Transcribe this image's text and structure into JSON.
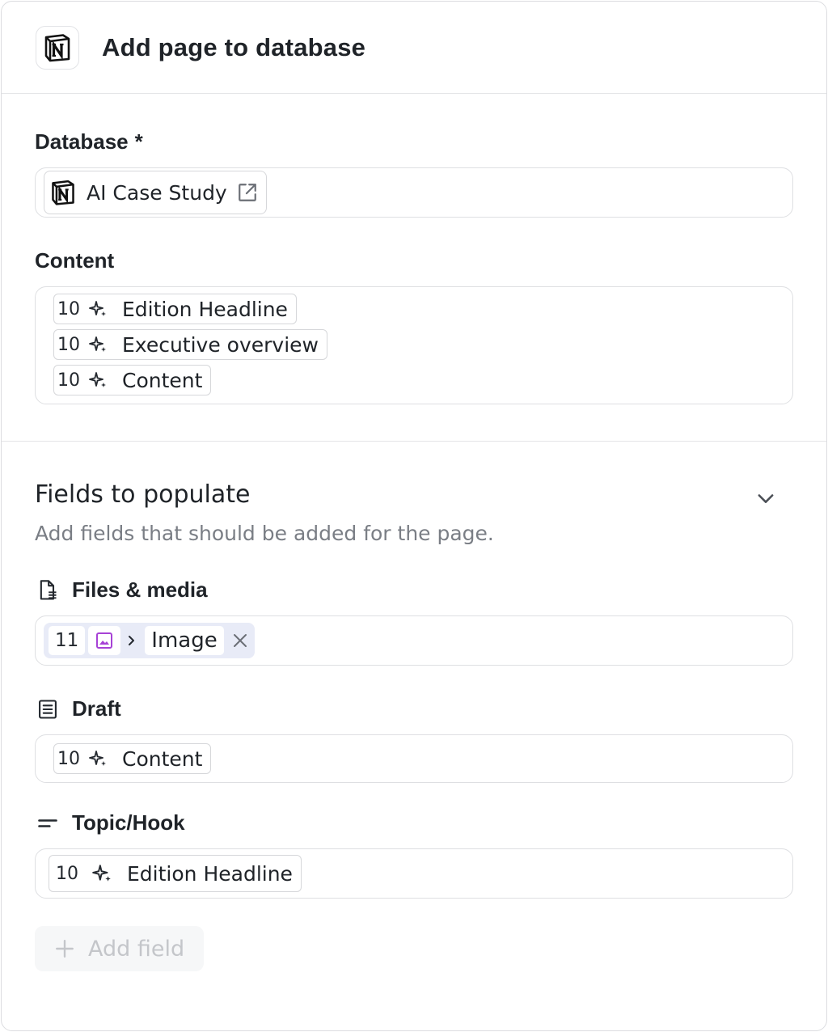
{
  "header": {
    "title": "Add page to database",
    "logo_icon": "notion-logo-icon"
  },
  "database": {
    "label": "Database",
    "required_marker": "*",
    "value": "AI Case Study",
    "value_icon": "notion-logo-icon",
    "action_icon": "external-link-icon"
  },
  "content": {
    "label": "Content",
    "items": [
      {
        "step": "10",
        "icon": "sparkle-icon",
        "label": "Edition Headline"
      },
      {
        "step": "10",
        "icon": "sparkle-icon",
        "label": "Executive overview"
      },
      {
        "step": "10",
        "icon": "sparkle-icon",
        "label": "Content"
      }
    ]
  },
  "fields_section": {
    "title": "Fields to populate",
    "subtitle": "Add fields that should be added for the page.",
    "toggle_icon": "chevron-down-icon",
    "fields": [
      {
        "label": "Files & media",
        "icon": "file-icon",
        "chip": {
          "step": "11",
          "type_icon": "image-icon",
          "label": "Image",
          "remove_icon": "close-icon"
        }
      },
      {
        "label": "Draft",
        "icon": "document-icon",
        "chip": {
          "step": "10",
          "icon": "sparkle-icon",
          "label": "Content"
        }
      },
      {
        "label": "Topic/Hook",
        "icon": "text-lines-icon",
        "chip": {
          "step": "10",
          "icon": "sparkle-icon",
          "label": "Edition Headline"
        }
      }
    ],
    "add_field_label": "Add field"
  },
  "colors": {
    "media_chip_bg": "#e8ebf7",
    "image_icon": "#a742d6",
    "border": "#dedfe2",
    "muted_text": "#7a7e85"
  }
}
